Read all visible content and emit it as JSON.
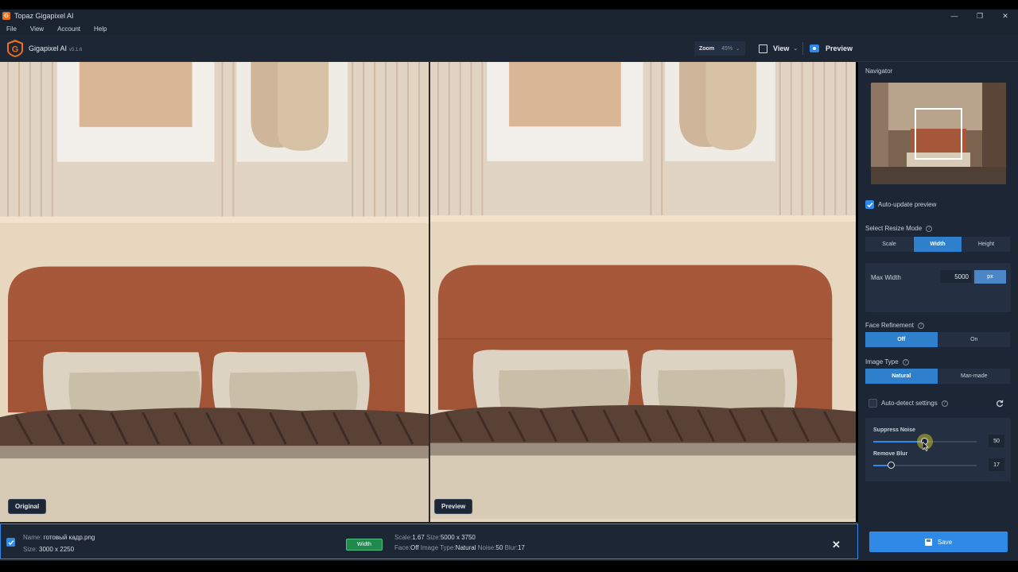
{
  "window": {
    "title": "Topaz Gigapixel AI",
    "controls": [
      "—",
      "❐",
      "✕"
    ]
  },
  "menu": [
    "File",
    "View",
    "Account",
    "Help"
  ],
  "header": {
    "app_name": "Gigapixel AI",
    "version": "v5.1.6",
    "zoom_label": "Zoom",
    "zoom_value": "45%",
    "view_label": "View",
    "preview_label": "Preview"
  },
  "panes": {
    "left_label": "Original",
    "right_label": "Preview"
  },
  "sidebar": {
    "navigator_title": "Navigator",
    "auto_update_label": "Auto-update preview",
    "auto_update_checked": true,
    "resize_mode_title": "Select Resize Mode",
    "resize_modes": [
      "Scale",
      "Width",
      "Height"
    ],
    "resize_mode_active": "Width",
    "max_width_label": "Max Width",
    "max_width_value": "5000",
    "max_width_unit": "px",
    "face_refinement_title": "Face Refinement",
    "face_refinement_options": [
      "Off",
      "On"
    ],
    "face_refinement_active": "Off",
    "image_type_title": "Image Type",
    "image_type_options": [
      "Natural",
      "Man-made"
    ],
    "image_type_active": "Natural",
    "auto_detect_label": "Auto-detect settings",
    "auto_detect_checked": false,
    "suppress_noise_label": "Suppress Noise",
    "suppress_noise_value": "50",
    "remove_blur_label": "Remove Blur",
    "remove_blur_value": "17"
  },
  "bottom": {
    "name_label": "Name:",
    "name_value": "готовый кадр.png",
    "size_label": "Size:",
    "size_value": "3000 x 2250",
    "mode_badge": "Width",
    "scale_label": "Scale:",
    "scale_value": "1.67",
    "out_size_label": "Size:",
    "out_size_value": "5000 x 3750",
    "face_label": "Face:",
    "face_value": "Off",
    "image_type_label": "Image Type:",
    "image_type_value": "Natural",
    "noise_label": "Noise:",
    "noise_value": "50",
    "blur_label": "Blur:",
    "blur_value": "17",
    "save_label": "Save"
  },
  "colors": {
    "accent": "#2e8ae6",
    "panel": "#1c2634",
    "badge_green": "#1f8a4c",
    "headboard": "#a8583a"
  }
}
